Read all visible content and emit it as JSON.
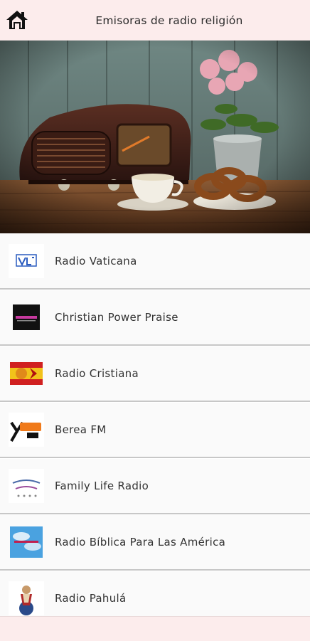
{
  "header": {
    "title": "Emisoras de radio religión",
    "home_icon": "home-icon"
  },
  "hero_image": {
    "description_icon": "vintage-radio-illustration"
  },
  "stations": [
    {
      "name": "Radio Vaticana",
      "icon": "radio-vaticana-logo"
    },
    {
      "name": "Christian Power Praise",
      "icon": "christian-power-praise-logo"
    },
    {
      "name": "Radio Cristiana",
      "icon": "radio-cristiana-logo"
    },
    {
      "name": "Berea FM",
      "icon": "berea-fm-logo"
    },
    {
      "name": "Family Life Radio",
      "icon": "family-life-radio-logo"
    },
    {
      "name": "Radio Bíblica Para Las América",
      "icon": "radio-biblica-logo"
    },
    {
      "name": "Radio Pahulá",
      "icon": "radio-pahula-logo"
    }
  ],
  "colors": {
    "header_bg": "#fcecec",
    "row_bg": "#fafafa",
    "divider": "#c7c7c7",
    "text": "#333333"
  }
}
